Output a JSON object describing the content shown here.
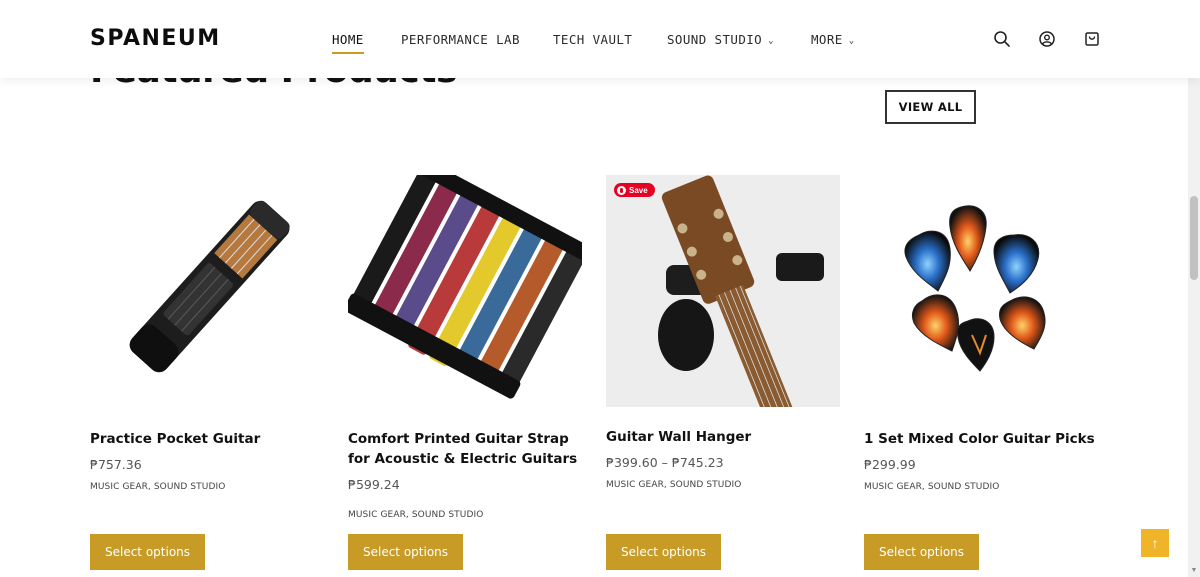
{
  "brand": {
    "logo": "SPANEUM",
    "accent": "#c79b25"
  },
  "nav": {
    "items": [
      {
        "label": "HOME",
        "active": true,
        "dropdown": false
      },
      {
        "label": "PERFORMANCE LAB",
        "active": false,
        "dropdown": false
      },
      {
        "label": "TECH VAULT",
        "active": false,
        "dropdown": false
      },
      {
        "label": "SOUND STUDIO",
        "active": false,
        "dropdown": true
      },
      {
        "label": "MORE",
        "active": false,
        "dropdown": true
      }
    ],
    "icons": [
      "search-icon",
      "user-icon",
      "cart-icon"
    ]
  },
  "section": {
    "title": "Featured Products",
    "view_all": "VIEW ALL"
  },
  "products": [
    {
      "title": "Practice Pocket Guitar",
      "price": "₱757.36",
      "categories": "MUSIC GEAR, SOUND STUDIO",
      "button": "Select options"
    },
    {
      "title": "Comfort Printed Guitar Strap for Acoustic & Electric Guitars",
      "price": "₱599.24",
      "categories": "MUSIC GEAR, SOUND STUDIO",
      "button": "Select options"
    },
    {
      "title": "Guitar Wall Hanger",
      "price": "₱399.60 – ₱745.23",
      "categories": "MUSIC GEAR, SOUND STUDIO",
      "button": "Select options",
      "badge": "Save"
    },
    {
      "title": "1 Set Mixed Color Guitar Picks",
      "price": "₱299.99",
      "categories": "MUSIC GEAR, SOUND STUDIO",
      "button": "Select options"
    }
  ],
  "scroll_top_icon": "arrow-up-icon"
}
